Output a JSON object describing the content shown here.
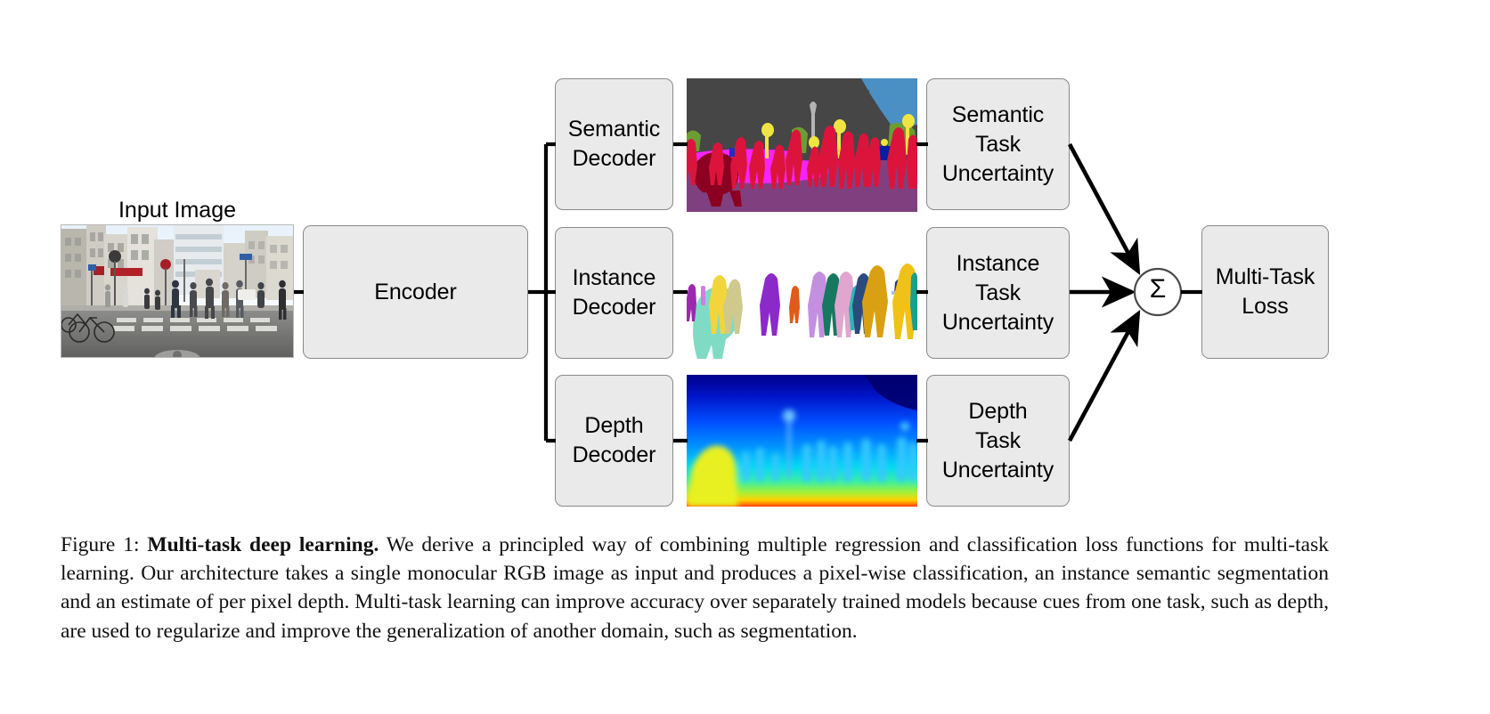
{
  "figure": {
    "input_image_title": "Input Image",
    "sum_symbol": "Σ"
  },
  "nodes": {
    "encoder": "Encoder",
    "semantic_decoder": "Semantic\nDecoder",
    "instance_decoder": "Instance\nDecoder",
    "depth_decoder": "Depth\nDecoder",
    "semantic_uncertainty": "Semantic\nTask\nUncertainty",
    "instance_uncertainty": "Instance\nTask\nUncertainty",
    "depth_uncertainty": "Depth\nTask\nUncertainty",
    "multi_task_loss": "Multi-Task\nLoss"
  },
  "caption": {
    "figure_number": "Figure 1:",
    "bold_title": "Multi-task deep learning.",
    "body": "We derive a principled way of combining multiple regression and classification loss functions for multi-task learning. Our architecture takes a single monocular RGB image as input and produces a pixel-wise classification, an instance semantic segmentation and an estimate of per pixel depth. Multi-task learning can improve accuracy over separately trained models because cues from one task, such as depth, are used to regularize and improve the generalization of another domain, such as segmentation."
  },
  "colors": {
    "box_fill": "#eaeaea",
    "box_border": "#8a8a8a",
    "line": "#000000",
    "semantic_road": "#804080",
    "semantic_sidewalk": "#f423ff",
    "semantic_person": "#dc143c",
    "semantic_building": "#464646",
    "semantic_sky": "#4a90c4",
    "semantic_vegetation": "#6b9e32",
    "semantic_trafficlight": "#f0e442",
    "semantic_car": "#8b0020",
    "depth_near": "#ff2a00",
    "depth_far": "#00008b"
  },
  "panels": {
    "semantic_segmentation": "semantic-segmentation-output",
    "instance_segmentation": "instance-segmentation-output",
    "depth_map": "depth-map-output",
    "input_photo": "input-rgb-photo"
  }
}
